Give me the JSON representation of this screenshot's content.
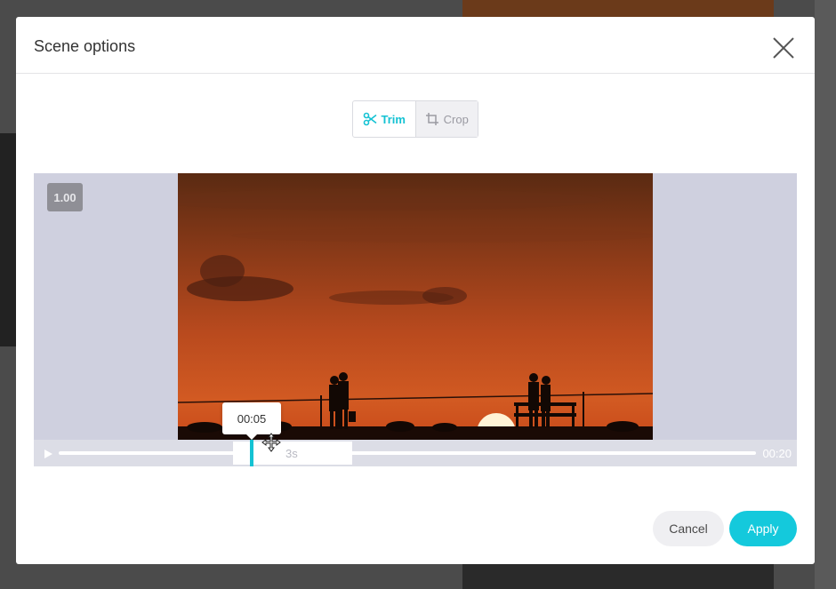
{
  "modal": {
    "title": "Scene options"
  },
  "tabs": [
    {
      "label": "Trim",
      "icon": "scissors-icon",
      "active": true
    },
    {
      "label": "Crop",
      "icon": "crop-icon",
      "active": false
    }
  ],
  "player": {
    "speed": "1.00",
    "tooltip_time": "00:05",
    "trim_duration": "3s",
    "total_duration": "00:20"
  },
  "footer": {
    "cancel_label": "Cancel",
    "apply_label": "Apply"
  },
  "colors": {
    "accent": "#14c2d3",
    "apply": "#14c9dc",
    "player_bg": "#cfd0df"
  }
}
